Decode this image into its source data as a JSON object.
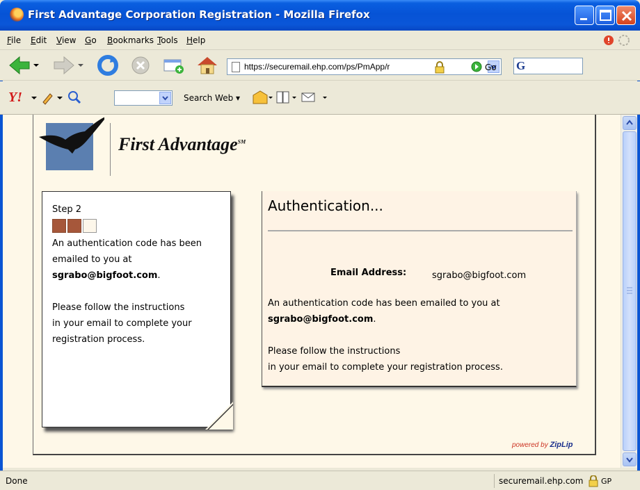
{
  "window": {
    "title": "First Advantage Corporation Registration - Mozilla Firefox"
  },
  "menubar": {
    "items": [
      "File",
      "Edit",
      "View",
      "Go",
      "Bookmarks",
      "Tools",
      "Help"
    ],
    "access_keys": [
      "F",
      "E",
      "V",
      "G",
      "B",
      "T",
      "H"
    ]
  },
  "navbar": {
    "url": "https://securemail.ehp.com/ps/PmApp/r",
    "go_label": "Go"
  },
  "yahoo_toolbar": {
    "logo": "Y!",
    "search_label": "Search Web"
  },
  "page": {
    "logo_text": "First Advantage",
    "logo_mark": "SM",
    "step": {
      "label": "Step 2",
      "progress": {
        "completed": 2,
        "total": 3
      },
      "line1": "An authentication code has been",
      "line2": "emailed to you at",
      "email": "sgrabo@bigfoot.com",
      "period": ".",
      "instr1": "Please follow the instructions",
      "instr2": "in your email to complete your",
      "instr3": "registration process."
    },
    "auth": {
      "title": "Authentication...",
      "email_label": "Email Address:",
      "email_value": "sgrabo@bigfoot.com",
      "line1": "An authentication code has been emailed to you at",
      "email": "sgrabo@bigfoot.com",
      "period": ".",
      "instr1": "Please follow the instructions",
      "instr2": "in your email to complete your registration process."
    },
    "powered_by": "powered by",
    "powered_brand": "ZipLip"
  },
  "statusbar": {
    "status": "Done",
    "domain": "securemail.ehp.com",
    "extra": "GP"
  },
  "colors": {
    "titlebar": "#0653d6",
    "page_bg": "#fef8e8",
    "progress_done": "#a6573a",
    "logo_blue": "#5b7fb0"
  }
}
